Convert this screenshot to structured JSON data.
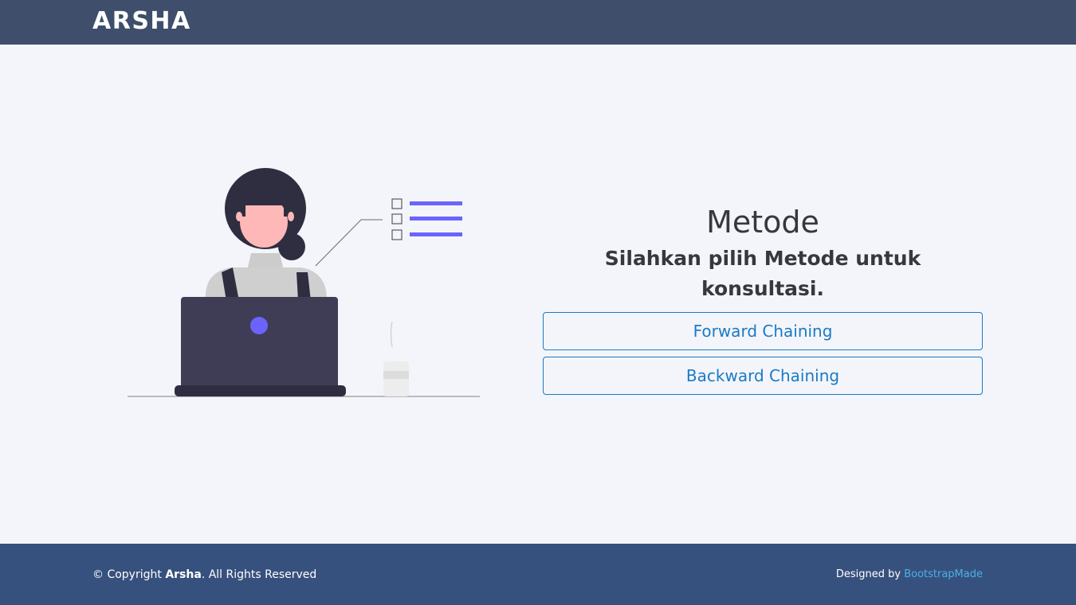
{
  "header": {
    "logo": "ARSHA"
  },
  "main": {
    "title": "Metode",
    "subtitle": "Silahkan pilih Metode untuk konsultasi.",
    "buttons": [
      {
        "label": "Forward Chaining"
      },
      {
        "label": "Backward Chaining"
      }
    ]
  },
  "footer": {
    "copyright_prefix": "© Copyright ",
    "brand": "Arsha",
    "copyright_suffix": ". All Rights Reserved",
    "designed_by": "Designed by ",
    "designer_link": "BootstrapMade"
  },
  "colors": {
    "header_bg": "#3e4e6b",
    "footer_bg": "#37517e",
    "page_bg": "#f3f5fa",
    "accent_blue": "#1b7ac5",
    "link_blue": "#47b2e4",
    "illustration_purple": "#6c63ff",
    "illustration_dark": "#3f3d56"
  },
  "icons": [
    "woman-at-laptop-illustration",
    "checklist-icon",
    "coffee-cup-icon"
  ]
}
